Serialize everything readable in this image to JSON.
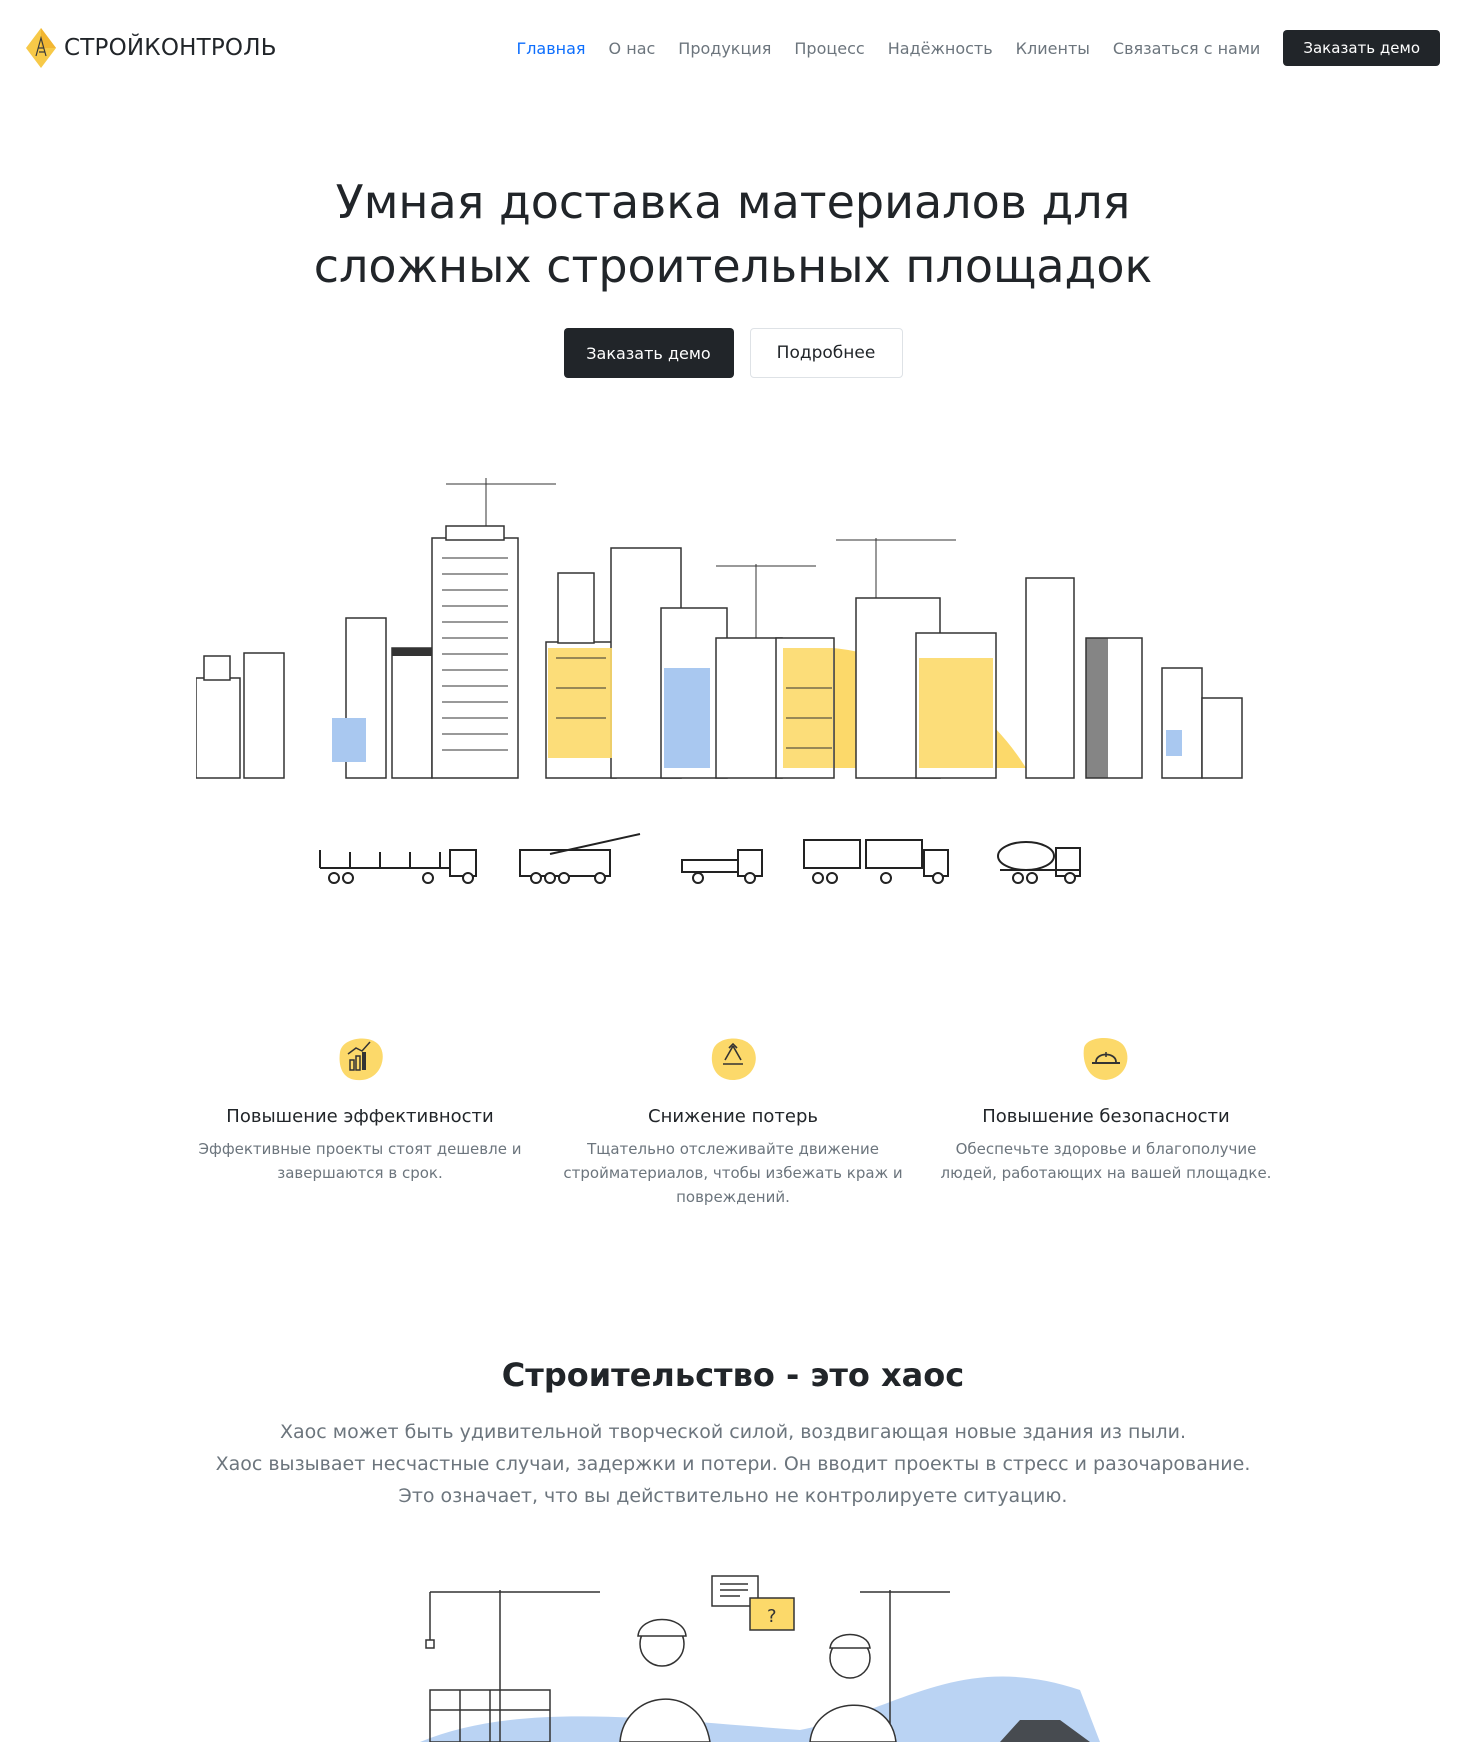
{
  "brand": {
    "name": "СТРОЙКОНТРОЛЬ",
    "logo_icon": "diamond-crane-logo",
    "accent": "#f7c948"
  },
  "nav": {
    "items": [
      {
        "label": "Главная",
        "active": true
      },
      {
        "label": "О нас"
      },
      {
        "label": "Продукция"
      },
      {
        "label": "Процесс"
      },
      {
        "label": "Надёжность"
      },
      {
        "label": "Клиенты"
      },
      {
        "label": "Связаться с нами"
      }
    ],
    "cta": "Заказать демо"
  },
  "hero": {
    "title_line1": "Умная доставка материалов для",
    "title_line2": "сложных строительных площадок",
    "primary_btn": "Заказать демо",
    "secondary_btn": "Подробнее",
    "illustration": "city-skyline-with-cranes",
    "trucks": [
      "flatbed-trailer-truck",
      "crane-truck",
      "small-flatbed-truck",
      "container-trailer-truck",
      "cement-mixer-truck"
    ]
  },
  "features": [
    {
      "icon": "chart-growth-icon",
      "title": "Повышение эффективности",
      "text": "Эффективные проекты стоят дешевле и завершаются в срок."
    },
    {
      "icon": "recycle-icon",
      "title": "Снижение потерь",
      "text": "Тщательно отслеживайте движение стройматериалов, чтобы избежать краж и повреждений."
    },
    {
      "icon": "hard-hat-icon",
      "title": "Повышение безопасности",
      "text": "Обеспечьте здоровье и благополучие людей, работающих на вашей площадке."
    }
  ],
  "chaos": {
    "title": "Строительство - это хаос",
    "line1": "Хаос может быть удивительной творческой силой, воздвигающая новые здания из пыли.",
    "line2": "Хаос вызывает несчастные случаи, задержки и потери. Он вводит проекты в стресс и разочарование.",
    "line3": "Это означает, что вы действительно не контролируете ситуацию.",
    "illustration": "workers-discussing-at-site"
  },
  "colors": {
    "dark": "#212529",
    "muted": "#6c757d",
    "active": "#0d6efd",
    "yellow": "#fcd96a",
    "blue": "#a9c8f0"
  }
}
